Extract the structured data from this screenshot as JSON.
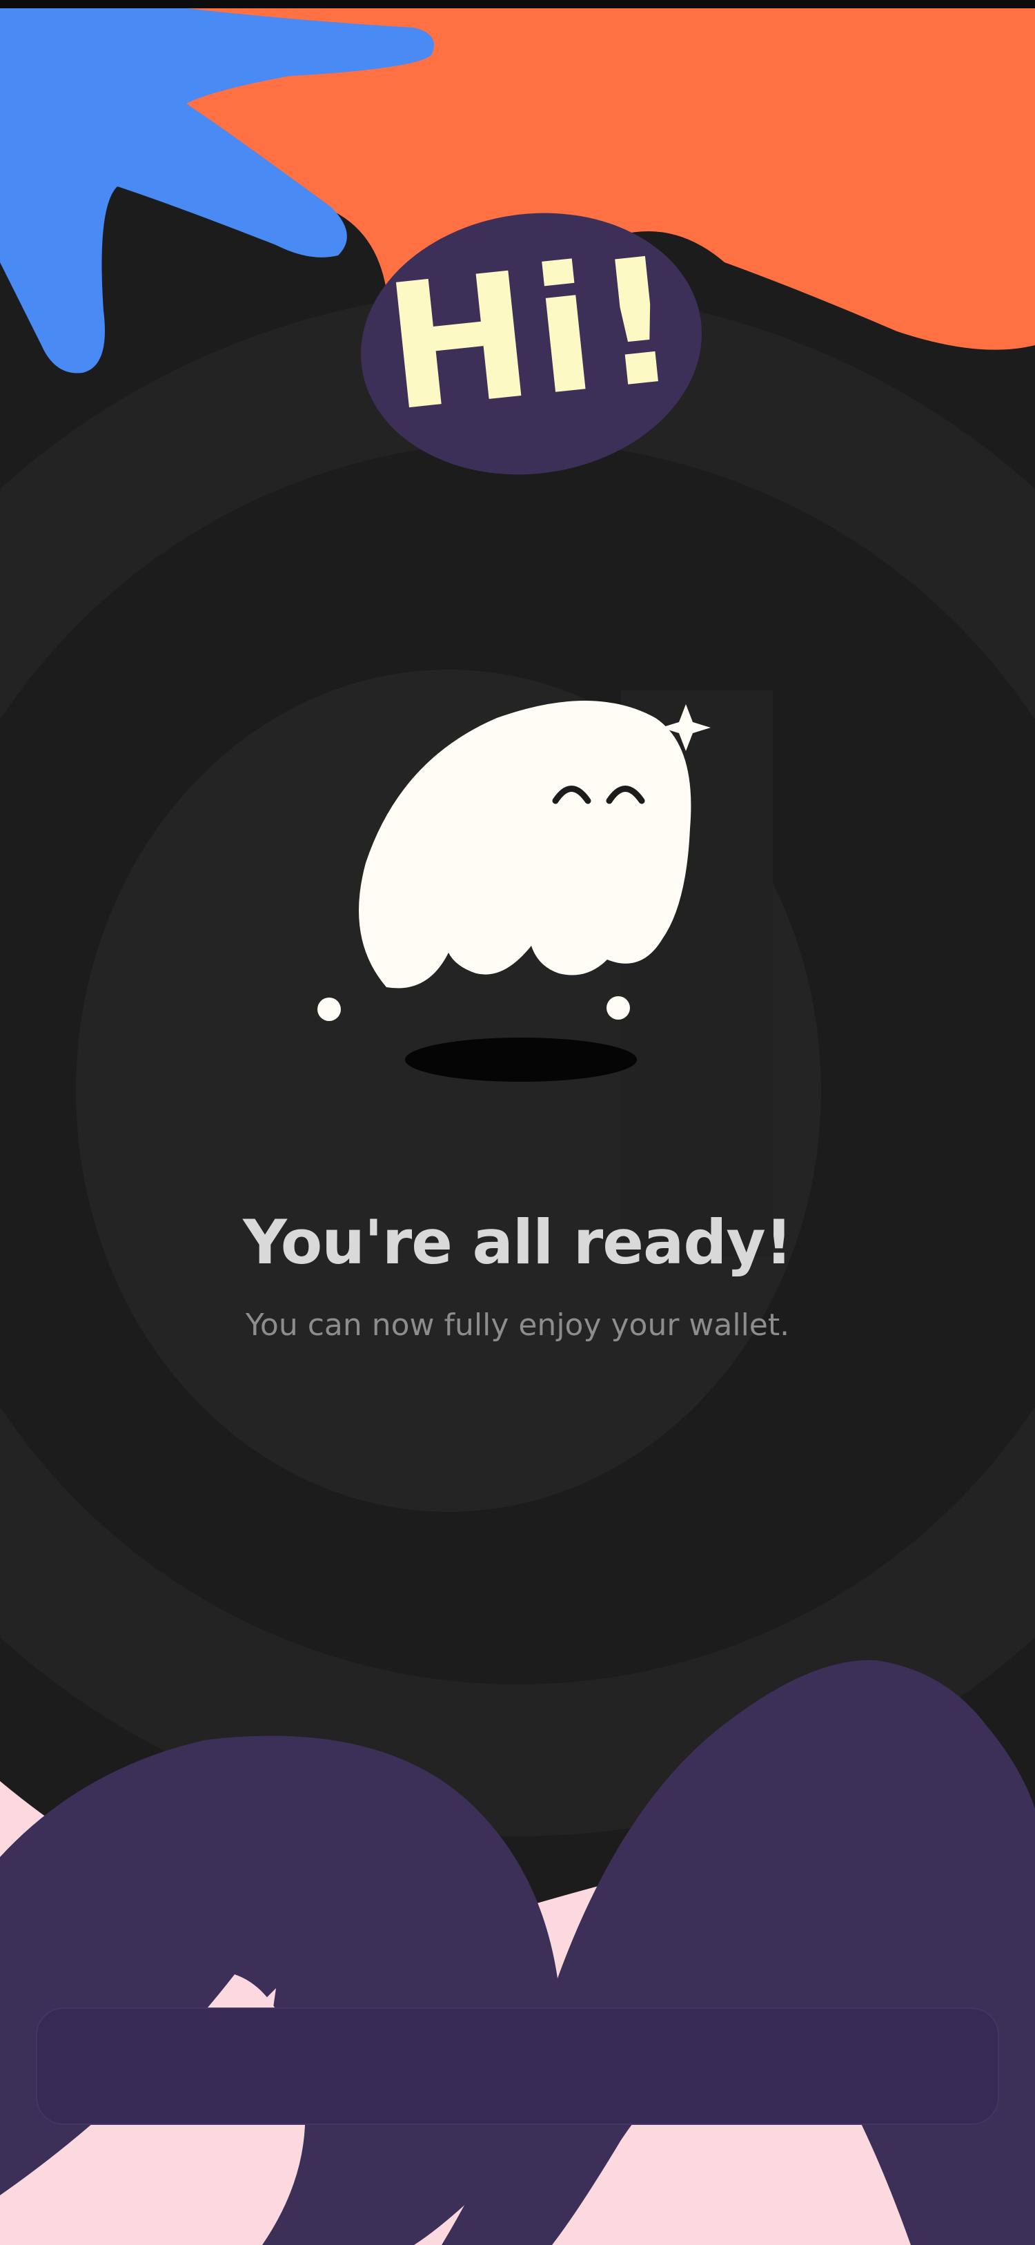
{
  "greeting_badge": {
    "text": "Hi!"
  },
  "success": {
    "title": "You're all ready!",
    "subtitle": "You can now fully enjoy your wallet."
  },
  "primary_action": {
    "label": ""
  },
  "colors": {
    "background": "#1c1c1c",
    "orange_blob": "#ff7143",
    "blue_blob": "#4a8af4",
    "purple": "#3c3058",
    "pink": "#fcd9de",
    "badge_text": "#fdf9c4",
    "ghost": "#fffdf6",
    "button": "#372b56"
  },
  "icons": [
    "ghost-mascot-icon",
    "sparkle-icon",
    "hi-badge"
  ]
}
